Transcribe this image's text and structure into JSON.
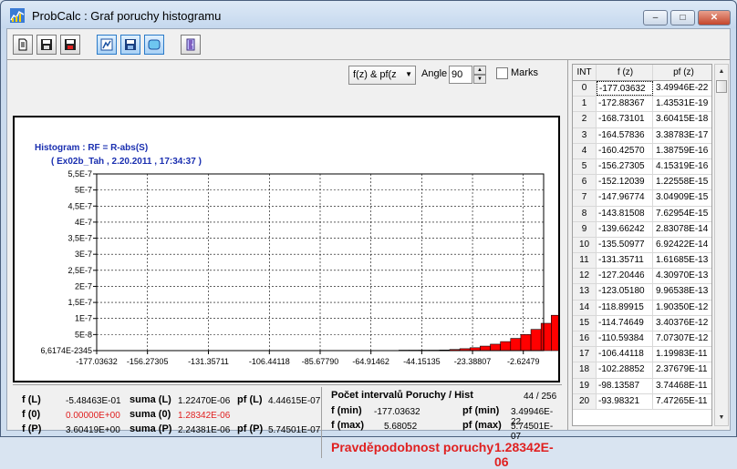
{
  "window": {
    "title": "ProbCalc : Graf poruchy histogramu"
  },
  "controls": {
    "mode_select": "f(z) & pf(z",
    "angle_label": "Angle",
    "angle_value": "90",
    "marks_label": "Marks",
    "marks_checked": false
  },
  "chart": {
    "title_line1": "Histogram  : RF = R-abs(S)",
    "title_line2": "( Ex02b_Tah , 2.20.2011 , 17:34:37 )"
  },
  "chart_data": {
    "type": "bar",
    "x_tick_labels": [
      "-177.03632",
      "-156.27305",
      "-131.35711",
      "-106.44118",
      "-85.67790",
      "-64.91462",
      "-44.15135",
      "-23.38807",
      "-2.62479"
    ],
    "y_tick_labels": [
      "6,6174E-2345",
      "5E-8",
      "1E-7",
      "1,5E-7",
      "2E-7",
      "2,5E-7",
      "3E-7",
      "3,5E-7",
      "4E-7",
      "4,5E-7",
      "5E-7",
      "5,5E-7"
    ],
    "ylim": [
      0,
      5.5e-07
    ],
    "xlim": [
      -177.03632,
      5.68052
    ],
    "bar_x_from": -53.5,
    "bar_width": 4.1527,
    "values": [
      1e-10,
      3e-10,
      6e-10,
      1e-09,
      2e-09,
      3.5e-09,
      6e-09,
      9e-09,
      1.4e-08,
      2e-08,
      2.8e-08,
      3.8e-08,
      5e-08,
      6.6e-08,
      8.5e-08,
      1.1e-07,
      1.38e-07,
      1.7e-07,
      2.05e-07,
      2.55e-07,
      3.6e-07,
      4.5e-07,
      5.75e-07
    ],
    "bar_color": "#ff0000",
    "grid": true
  },
  "summary": {
    "fL_label": "f (L)",
    "fL_value": "-5.48463E-01",
    "f0_label": "f (0)",
    "f0_value": "0.00000E+00",
    "fP_label": "f (P)",
    "fP_value": "3.60419E+00",
    "sumaL_label": "suma (L)",
    "sumaL_value": "1.22470E-06",
    "suma0_label": "suma (0)",
    "suma0_value": "1.28342E-06",
    "sumaP_label": "suma (P)",
    "sumaP_value": "2.24381E-06",
    "pfL_label": "pf (L)",
    "pfL_value": "4.44615E-07",
    "pfP_label": "pf (P)",
    "pfP_value": "5.74501E-07",
    "intervals_label": "Počet intervalů Poruchy / Hist",
    "intervals_value": "44 / 256",
    "fmin_label": "f (min)",
    "fmin_value": "-177.03632",
    "fmax_label": "f (max)",
    "fmax_value": "5.68052",
    "pfmin_label": "pf (min)",
    "pfmin_value": "3.49946E-22",
    "pfmax_label": "pf (max)",
    "pfmax_value": "5.74501E-07",
    "prob_label": "Pravděpodobnost poruchy",
    "prob_value": "1.28342E-06"
  },
  "table": {
    "headers": [
      "INT",
      "f (z)",
      "pf (z)"
    ],
    "rows": [
      [
        "0",
        "-177.03632",
        "3.49946E-22"
      ],
      [
        "1",
        "-172.88367",
        "1.43531E-19"
      ],
      [
        "2",
        "-168.73101",
        "3.60415E-18"
      ],
      [
        "3",
        "-164.57836",
        "3.38783E-17"
      ],
      [
        "4",
        "-160.42570",
        "1.38759E-16"
      ],
      [
        "5",
        "-156.27305",
        "4.15319E-16"
      ],
      [
        "6",
        "-152.12039",
        "1.22558E-15"
      ],
      [
        "7",
        "-147.96774",
        "3.04909E-15"
      ],
      [
        "8",
        "-143.81508",
        "7.62954E-15"
      ],
      [
        "9",
        "-139.66242",
        "2.83078E-14"
      ],
      [
        "10",
        "-135.50977",
        "6.92422E-14"
      ],
      [
        "11",
        "-131.35711",
        "1.61685E-13"
      ],
      [
        "12",
        "-127.20446",
        "4.30970E-13"
      ],
      [
        "13",
        "-123.05180",
        "9.96538E-13"
      ],
      [
        "14",
        "-118.89915",
        "1.90350E-12"
      ],
      [
        "15",
        "-114.74649",
        "3.40376E-12"
      ],
      [
        "16",
        "-110.59384",
        "7.07307E-12"
      ],
      [
        "17",
        "-106.44118",
        "1.19983E-11"
      ],
      [
        "18",
        "-102.28852",
        "2.37679E-11"
      ],
      [
        "19",
        "-98.13587",
        "3.74468E-11"
      ],
      [
        "20",
        "-93.98321",
        "7.47265E-11"
      ]
    ]
  }
}
